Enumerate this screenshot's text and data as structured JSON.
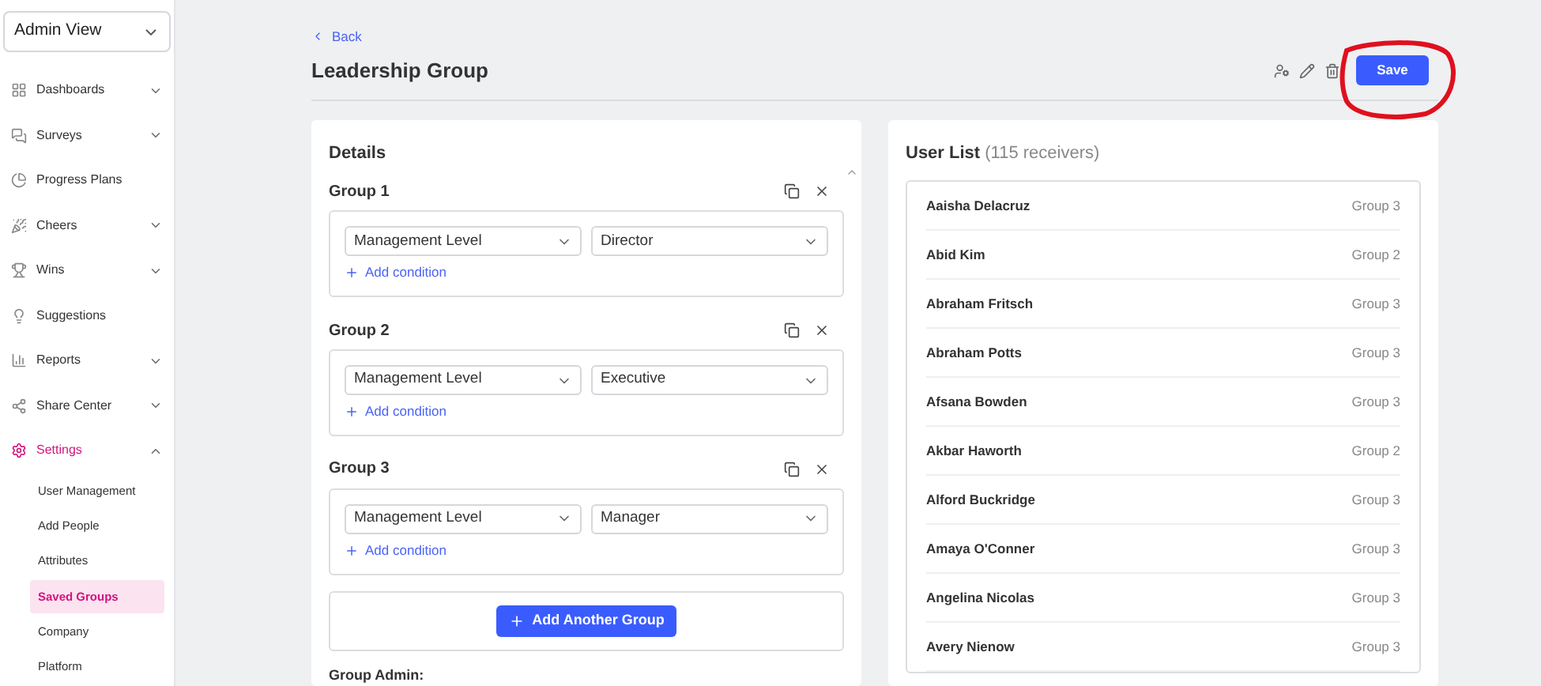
{
  "sidebar": {
    "view_select": "Admin View",
    "items": [
      {
        "label": "Dashboards",
        "expanded": false,
        "selected": false
      },
      {
        "label": "Surveys",
        "expanded": false,
        "selected": false
      },
      {
        "label": "Progress Plans",
        "selected": false
      },
      {
        "label": "Cheers",
        "expanded": false,
        "selected": false
      },
      {
        "label": "Wins",
        "expanded": false,
        "selected": false
      },
      {
        "label": "Suggestions",
        "selected": false
      },
      {
        "label": "Reports",
        "expanded": false,
        "selected": false
      },
      {
        "label": "Share Center",
        "expanded": false,
        "selected": false
      },
      {
        "label": "Settings",
        "expanded": true,
        "selected": true,
        "children": [
          {
            "label": "User Management",
            "selected": false
          },
          {
            "label": "Add People",
            "selected": false
          },
          {
            "label": "Attributes",
            "selected": false
          },
          {
            "label": "Saved Groups",
            "selected": true
          },
          {
            "label": "Company",
            "selected": false
          },
          {
            "label": "Platform",
            "selected": false
          }
        ]
      }
    ]
  },
  "header": {
    "back": "Back",
    "title": "Leadership Group",
    "save": "Save"
  },
  "details": {
    "title": "Details",
    "groups": [
      {
        "label": "Group 1",
        "attribute": "Management Level",
        "value": "Director",
        "add_condition": "Add condition"
      },
      {
        "label": "Group 2",
        "attribute": "Management Level",
        "value": "Executive",
        "add_condition": "Add condition"
      },
      {
        "label": "Group 3",
        "attribute": "Management Level",
        "value": "Manager",
        "add_condition": "Add condition"
      }
    ],
    "add_group": "Add Another Group",
    "group_admin": "Group Admin:"
  },
  "user_list": {
    "title": "User List",
    "count": "(115 receivers)",
    "users": [
      {
        "name": "Aaisha Delacruz",
        "group": "Group 3"
      },
      {
        "name": "Abid Kim",
        "group": "Group 2"
      },
      {
        "name": "Abraham Fritsch",
        "group": "Group 3"
      },
      {
        "name": "Abraham Potts",
        "group": "Group 3"
      },
      {
        "name": "Afsana Bowden",
        "group": "Group 3"
      },
      {
        "name": "Akbar Haworth",
        "group": "Group 2"
      },
      {
        "name": "Alford Buckridge",
        "group": "Group 3"
      },
      {
        "name": "Amaya O'Conner",
        "group": "Group 3"
      },
      {
        "name": "Angelina Nicolas",
        "group": "Group 3"
      },
      {
        "name": "Avery Nienow",
        "group": "Group 3"
      }
    ]
  }
}
